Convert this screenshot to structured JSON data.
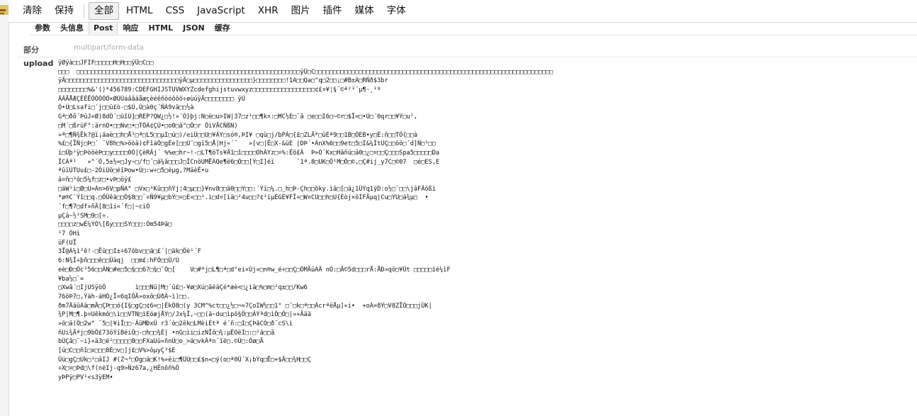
{
  "toolbar": {
    "clear_label": "清除",
    "keep_label": "保持",
    "filters": [
      {
        "label": "全部",
        "active": true
      },
      {
        "label": "HTML",
        "active": false
      },
      {
        "label": "CSS",
        "active": false
      },
      {
        "label": "JavaScript",
        "active": false
      },
      {
        "label": "XHR",
        "active": false
      },
      {
        "label": "图片",
        "active": false
      },
      {
        "label": "插件",
        "active": false
      },
      {
        "label": "媒体",
        "active": false
      },
      {
        "label": "字体",
        "active": false
      }
    ]
  },
  "detail_tabs": [
    {
      "label": "参数",
      "active": false
    },
    {
      "label": "头信息",
      "active": false
    },
    {
      "label": "Post",
      "active": true
    },
    {
      "label": "响应",
      "active": false
    },
    {
      "label": "HTML",
      "active": false
    },
    {
      "label": "JSON",
      "active": false
    },
    {
      "label": "缓存",
      "active": false
    }
  ],
  "post": {
    "part_label": "部分",
    "part_value": "multipart/form-data",
    "upload_label": "upload",
    "upload_lines": [
      "ÿØÿà\u0000\u0010JFIF\u0000\u0001\u0001\u0001\u0000H\u0000H\u0000\u0000ÿÛ\u0000C\u0000\u0003",
      "\u0002\u0002\u0003  \u0002\u0002\u0002\u0003\u0003\u0003\u0003\u0004\u0003\u0003\u0004\u0005\b\u0005\u0005\u0004\u0004\u0005\n\u0007\u0007\u0006\b\f\n\f\f\u000b\n\u000b\u000b\r\u000e\u0012\u0010\r\u000e\u0011\u000e\u000b\u000b\u0010\u0016\u0010\u0011\u0013\u0014\u0015\u0015\u0015\f\u000f\u0017\u0018\u0016\u0014\u0018\u0012\u0014\u0015\u0014ÿÛ\u0000C\u0001\u0003\u0004\u0004\u0005\u0004\u0005\t\u0005\u0005\t\u0014\r\u000b\r\u0014\u0014\u0014\u0014\u0014\u0014\u0014\u0014\u0014\u0014\u0014\u0014\u0014\u0014\u0014\u0014\u0014\u0014\u0014\u0014\u0014\u0014\u0014\u0014\u0014\u0014\u0014\u0014\u0014\u0014\u0014\u0014\u0014\u0014\u0014\u0014\u0014\u0014\u0014\u0014\u0014\u0014\u0014\u0014\u0014\u0014\u0014\u0014\u0014\u0014",
      "ÿÄ\u0000\u001f\u0000\u0000\u0001\u0005\u0001\u0001\u0001\u0001\u0001\u0001\u0000\u0000\u0000\u0000\u0000\u0000\u0000\u0000\u0001\u0002\u0003\u0004\u0005\u0006\u0007\b\t\n\u000bÿÄ\u0000µ\u0010\u0000\u0002\u0001\u0003\u0003\u0002\u0004\u0003\u0005\u0005\u0004\u0004\u0000\u0000\u0001}\u0001\u0002\u0003\u0000\u0004\u0011\u0005\u0012!1A\u0006\u0013Qa\u0007\"q\u00142¡\b#B±Á\u0015RÑð$3br",
      "\t\n\u0016\u0017\u0018\u0019\u001a%&'()*456789:CDEFGHIJSTUVWXYZcdefghijstuvwxyz¢£¤¥¦§¨©ª²³´µ¶·¸¹º",
      "ÂÃÄÅÆÇÈÉÊÒÓÔÕÖ×ØÙÚáâãäåæçèéêñòóôõö÷øùúÿÄ\u0000\u001f\u0001\u0000\u0003\u0001\u0001\u0001 ÿÚ",
      "Ò•Ú\u0012Lsafi\u0016´j\u0000\u0014ü£ò-\u0015$Ú,Ú\u0011à0ç´ÑÀ9vä\u0014\u0011½à",
      "Gª\u0011ðõ´ÞûJ«Ø)8dÓ´\u0011ûîÚ]\u0010REP?QW¿\u0012½!»´Ó}þj:N\u0011è\u0011u>IW|37\u0011z¹\u0011\u0011¶k¤:\u0011MC½E\u0012¨â \u0011e\u0011\u0011I6\u0011~©r\u0011$Ï=\u0011•Ú\u0011´0qr\u0011\u0011¥Ý\u0011u²,",
      "\u0012M´\u0011ßrüF°:ärnO•\u0011\u0011Nv\u0012•\u0012TÕÃ¢ÇÚ•\u0011o0\u0011ä°\u0011Ô\u0011r ÔìVÄCÑßN)",
      "»ª\u0011¶Ñ¾Êk?@ï¡äaè\u0011\u0011h\u0011Å¹\u0011ª\u0011L5\u0011\u0011µI\u0011ú\u0011)/eiÜ\u0011\u0011U\u0011¥ÃY\u0011só®,ÞI¥ \u0011qü\u0011j/bPÀ\u0011{£\u0011ZLÄ*\u0011ûÉª9\u0011\u00111B\u0011ÕEB•y\u0011É:ñ\u0011\u0011TÖ{\u0011\u0011à",
      "%£\u0011{ÏÑj\u0011Þ\u0011´ ¨V8h\u0011%>öòä)¢FîàÕ\u0011gÈe[\u0011\u0011Ú¨\u0011gï5\u0011Å|Hj«´¨   »[v\u0011|Ë\u0011X-&üE |DÞ´•ÀnX%6\u0011\u00119et\u00115\u0011Ì&¼ÎtUÇ\u0011\u0011öö\u0011´d]Ñ\u0011¹\u0011\u0011",
      "ï\u0011Ûþ²ÿ\u0012ÞòöèÞ\u0011\u0011y\u0011\u0011\u0011\u00110Ó|ÇèRÂj´ %%e\u0011hr~!-\u0011LT¶öTs¥Ä1\u0011î\u0011\u0011\u0011\u0011OhÃYz\u0011¤%:Êö£Â  Þ»Ó´Kx\u0011Hâñú\u0011ä0\u0011¿\u0011¤\u0011\u0011Ç\u0011\u0011\u0011Spa5\u0011\u0011\u0011\u0011\u0011Da",
      "ÎCÀª¹   »^´Ó,5±½=\u0011Jy~\u0011/f\u0011´\u0011ä¼ã\u0011\u0011\u0011J\u0011ÎCnöUMËÀQe¶ë6\u0011Ó\u0011\u0011[Ý\u0011I]éï      ¨1ª.8\u0011UK\u0011Õ¹M\u0011Ô\u0011©,\u0011Ç#ij_y7C\u0011©07  \u0011é\u0011ES,E",
      "ªûïÚTUu£\u0011-2ÓiÜö\u0011éîÞow•Ú\u0011:w÷\u00115\u0011èµg,?MäèÊ•u",
      "â¤ñ\u0011³ô\u00115¼f\u0011z\u0011•vÞ\u0011öÿ£",
      "\u0011äW¹i\u0011Ø\u0011U=Àn>6V\u0011pÑA° \u0011Vx\u0011³Kû\u0011\u0011ñÝj¦4\u0011µ\u0011\u0011}¥nv8\u0011\u0011ä0\u0011\u0011Y\u0011\u0011:´Ýï\u0011¼.\u0011_h\u0011Þ-Çh\u0011\u0011ôky.ìâ\u0011[\u0011ä¿1ÜÝq1ýD:o½\u0011¨\u0011\u0011\\jâFÂößì",
      "*ø®C´Ýî\u0011\u0011q.\u0011ÔÜêä\u0011\u0011Ô§8\u0011\u0011¨¤Ñ9¥µ\u0011bÝ\u0011÷\u0011E«\u0011\u0011¹.ì\u0011d¤[ìä\u0011²4u\u0011\u0011?¢¹ïµÉGÈ¥FÎ÷\u0011W¤CU\u0011\u0011h\u0011U{Éòj×öÌFÄµq|Cu\u0011ÝU\u0011ä¾µ\u0011  •",
      "´f\u0011¶7\u0011df»ñÄ[8\u00111i«´f\u0011|~ciÓ",
      "µÇä~½²SM\u00119\u0011[÷.",
      "\u0011\u0011\u0011\u0011z\u0011wÈ¼ÝÓ\\[ßy\u0011\u0011\u0011SY\u0011\u0011\u0011:Õm54Þä\u0011",
      "¹7 ÕHì",
      "üF(UÏ",
      "3Ï@À¼ì²ê!-\u0011Ëû\u0011\u0011I±÷67ôbv\u0011\u0011ä\u0011£´|\u0011äk\u0011Ôè¹´F",
      "6:N¾Î÷þñ\u0011\u0011\u0011ê\u0011\u0011Ûàqj  \u0011\u0011m£:hFÕ\u0011\u0011Ü/Ú",
      "eè\u0011Ð\u0011Ôc²56\u0011\u0011ÂN\u0011#e\u00115\u0011§\u0011\u00116?\u0011§\u0011¯Ó\u0011[    V\u0011#*j\u0011L¶\u0011ª\u0011d°ei×Új»\u0011n®w_é÷\u0011\u0011Ç\u0011ÖMÄüÀÄ nÓ:\u0011Ä©5d\u0011\u0011\u0011rÅ:ÅÐ»qö\u0011¥Üt \u0011\u0011\u0011\u0011\u0011ìé¼ìF",
      "¥ba½\u0011¨=",
      "\u0011Xwã´\u0011IjUSÿöÕ        ì\u0011\u0011\u0011Nü|M\u0011´û£\u0011-¥ø\u0011Xú\u0011ãëäÇé*æè<\u0011¿ìä\u0011%\u0011m\u0011²q±\u0011\u0011/Kw6",
      "76öÞ7\u0011,Ýàh-áHÒ¿Ï=6qIÔÄ»oxô\u0011ÜðÂ~ì)\u0011\u0011.",
      "ðm7ÄäûÀä\u0011mÄ\u0011ÇÞ\u0011\u0011ó{I§\u0011gÇ\u0011¢6=\u0011|ÊkÒ8\u0011(y 3CM^%ct\u0011\u0011¿½\u0011¬=7ÇoIW½\u0011\u00111° \u0011¯\u0011k\u0011ª\u0011\u0011ÃcrªëÅµ]«i•  +oÀ=8Ý\u0011V8ZÏÓ\u0011\u0011\u0011jÜK|",
      "¾P|M\u0011¶.þ¤Uêkmô\u0011\\ì\u0011\u0011VTN\u0011ìEóæjÅÝ\u0011/Jx¼Ï,~\u0011\u0011(ä~du\u0011ìpô§Ö\u0011\u0011ÂÝªd\u0011ìÖ\u0011Ö\u0011|»»Äää",
      "»ö\u0011ä(Ö\u00112w° ¨5\u0011|¥iÏ\u0011\u0011-ÃüMÐxÜ r3´ò\u00112ëk\u0011LMèiÉtª é´ñ:\u0011I\u0011ÇÞâCÓ\u0011ð¨cS\\ì",
      "ñUi¾Äªj\u00119bÖ£73öÝïBéiÖ\u0011-\u0011h\u0011\u0011¾È| •nG\u0011ìi\u0011izNÏö\u0011¾:µÉOëÍ\u0011:\u0011²ä\u0011\u0011ã",
      "bÜÇâ\u0011¨~i}«ä3\u0011ë¹\u0011\u0011\u0011\u0011\u00118\u0011\u0011FXaUû«ñnÚ\u0011o_>ä\u0011vkÃªn´ïë\u0011.©Ü\u0011:Öø\u0011Ä",
      "[ú\u0011C\u0011\u0011ñî\u0011x\u0011\u0011\u00118É\u0011v\u0011]j£\u0011V%>ôµyÇ³$E",
      "Ûú\u0011gÇ\u0011Uk\u0011¹\u0011âIJ #(Z¬³\u0011Ög\u0011ä\u0011K!%»ëi\u0011¶ÜÚ\u0011\u0011£$n«\u0011ý(o\u0011ª0Ü´X¡bÝq\u0011Ë\u0011+$Ä\u0011\u0011¾H\u0011\u0011Ç",
      "÷X\u0011¤\u0011Þd\u0011\\f(nëIj-q9>Ñz67a,¿HÊnõñ%Ö",
      "yÞPÿ\u0011PV¹<s3ÿEM•"
    ]
  }
}
